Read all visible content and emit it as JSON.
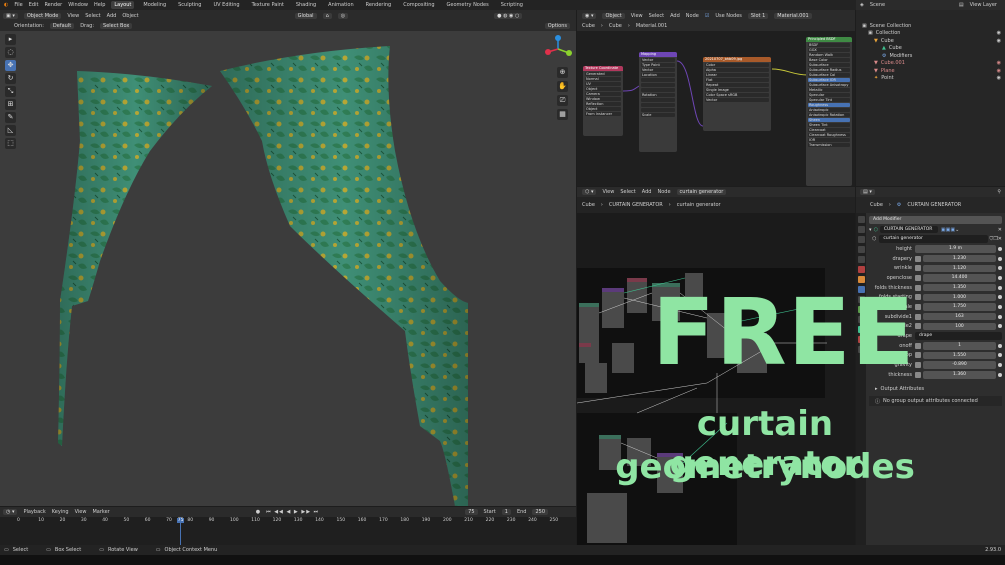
{
  "top_menu": [
    "File",
    "Edit",
    "Render",
    "Window",
    "Help"
  ],
  "workspaces": [
    {
      "label": "Layout",
      "active": true
    },
    {
      "label": "Modeling"
    },
    {
      "label": "Sculpting"
    },
    {
      "label": "UV Editing"
    },
    {
      "label": "Texture Paint"
    },
    {
      "label": "Shading"
    },
    {
      "label": "Animation"
    },
    {
      "label": "Rendering"
    },
    {
      "label": "Compositing"
    },
    {
      "label": "Geometry Nodes"
    },
    {
      "label": "Scripting"
    }
  ],
  "viewport": {
    "mode": "Object Mode",
    "menus": [
      "View",
      "Select",
      "Add",
      "Object"
    ],
    "orientation_label": "Orientation:",
    "orientation": "Default",
    "drag_label": "Drag:",
    "drag": "Select Box",
    "transform": "Global",
    "options": "Options",
    "tools": [
      "▸",
      "◌",
      "✥",
      "↻",
      "⤡",
      "⊞",
      "✎",
      "◺",
      "⬚"
    ]
  },
  "shader_editor": {
    "object": "Object",
    "menus": [
      "View",
      "Select",
      "Add",
      "Node"
    ],
    "use_nodes": "Use Nodes",
    "slot": "Slot 1",
    "material": "Material.001",
    "breadcrumb": [
      "Cube",
      "Cube",
      "Material.001"
    ],
    "nodes": [
      {
        "title": "Texture Coordinate",
        "color": "#b1385d",
        "rows": [
          "Generated",
          "Normal",
          "UV",
          "Object",
          "Camera",
          "Window",
          "Reflection",
          "Object",
          "From Instancer"
        ]
      },
      {
        "title": "Mapping",
        "color": "#6e46b5",
        "rows": [
          "Vector",
          "Type  Point",
          "Vector",
          "Location",
          "Rotation",
          "Scale"
        ]
      },
      {
        "title": "20210707_bhb09.jpg",
        "color": "#a85a2a",
        "rows": [
          "Color",
          "Alpha",
          "Linear",
          "Flat",
          "Repeat",
          "Single Image",
          "Color Space  sRGB",
          "Vector"
        ]
      },
      {
        "title": "Principled BSDF",
        "color": "#3f8a44",
        "rows": [
          "BSDF",
          "GGX",
          "Random Walk",
          "Base Color",
          "Subsurface",
          "Subsurface Radius",
          "Subsurface Col",
          "Subsurface IOR",
          "Subsurface Anisotropy",
          "Metallic",
          "Specular",
          "Specular Tint",
          "Roughness",
          "Anisotropic",
          "Anisotropic Rotation",
          "Sheen",
          "Sheen Tint",
          "Clearcoat",
          "Clearcoat Roughness",
          "IOR",
          "Transmission"
        ]
      }
    ]
  },
  "outliner": {
    "title": "Scene",
    "view_layer": "View Layer",
    "items": [
      {
        "label": "Scene Collection",
        "indent": 0
      },
      {
        "label": "Collection",
        "indent": 1
      },
      {
        "label": "Cube",
        "indent": 2
      },
      {
        "label": "Cube",
        "indent": 3
      },
      {
        "label": "Modifiers",
        "indent": 3
      },
      {
        "label": "Cube.001",
        "indent": 2
      },
      {
        "label": "Plane",
        "indent": 2
      },
      {
        "label": "Point",
        "indent": 2
      }
    ]
  },
  "geometry_nodes": {
    "menus": [
      "View",
      "Select",
      "Add",
      "Node"
    ],
    "tree_name": "curtain generator",
    "breadcrumb": [
      "Cube",
      "CURTAIN GENERATOR",
      "curtain generator"
    ]
  },
  "properties": {
    "object": "Cube",
    "modifier": "CURTAIN GENERATOR",
    "add_modifier": "Add Modifier",
    "modifier_name": "CURTAIN GENERATOR",
    "node_group": "curtain generator",
    "fields": [
      {
        "label": "height",
        "value": "1.9 m"
      },
      {
        "label": "drapery",
        "value": "1.230"
      },
      {
        "label": "wrinkle",
        "value": "1.120"
      },
      {
        "label": "openclose",
        "value": "14.400"
      },
      {
        "label": "folds thickness",
        "value": "1.350"
      },
      {
        "label": "folds starting",
        "value": "1.000"
      },
      {
        "label": "open scale",
        "value": "1.750"
      },
      {
        "label": "subdivide1",
        "value": "163"
      },
      {
        "label": "subdivide2",
        "value": "100"
      },
      {
        "label": "drape",
        "value": "drape",
        "dark": true
      },
      {
        "label": "onoff",
        "value": "1"
      },
      {
        "label": "drop",
        "value": "1.550"
      },
      {
        "label": "gravity",
        "value": "-0.890"
      },
      {
        "label": "thickness",
        "value": "1.360"
      }
    ],
    "output_attributes": "Output Attributes",
    "no_output": "No group output attributes connected"
  },
  "timeline": {
    "menus": [
      "Playback",
      "Keying",
      "View",
      "Marker"
    ],
    "current_frame": "75",
    "start_label": "Start",
    "start": "1",
    "end_label": "End",
    "end": "250",
    "ticks": [
      "0",
      "10",
      "20",
      "30",
      "40",
      "50",
      "60",
      "70",
      "75",
      "80",
      "90",
      "100",
      "110",
      "120",
      "130",
      "140",
      "150",
      "160",
      "170",
      "180",
      "190",
      "200",
      "210",
      "220",
      "230",
      "240",
      "250"
    ]
  },
  "status_bar": {
    "items": [
      "Select",
      "Box Select",
      "Rotate View",
      "Object Context Menu"
    ],
    "version": "2.93.0"
  },
  "overlay": {
    "headline": "FREE",
    "line1": "curtain generator",
    "line2": "geometrynodes"
  },
  "colors": {
    "overlay": "#8fe5a3",
    "accent": "#4772b3",
    "curtain_base": "#3f8f76",
    "curtain_leaf": "#2f7d55",
    "curtain_gold": "#b6a735"
  }
}
